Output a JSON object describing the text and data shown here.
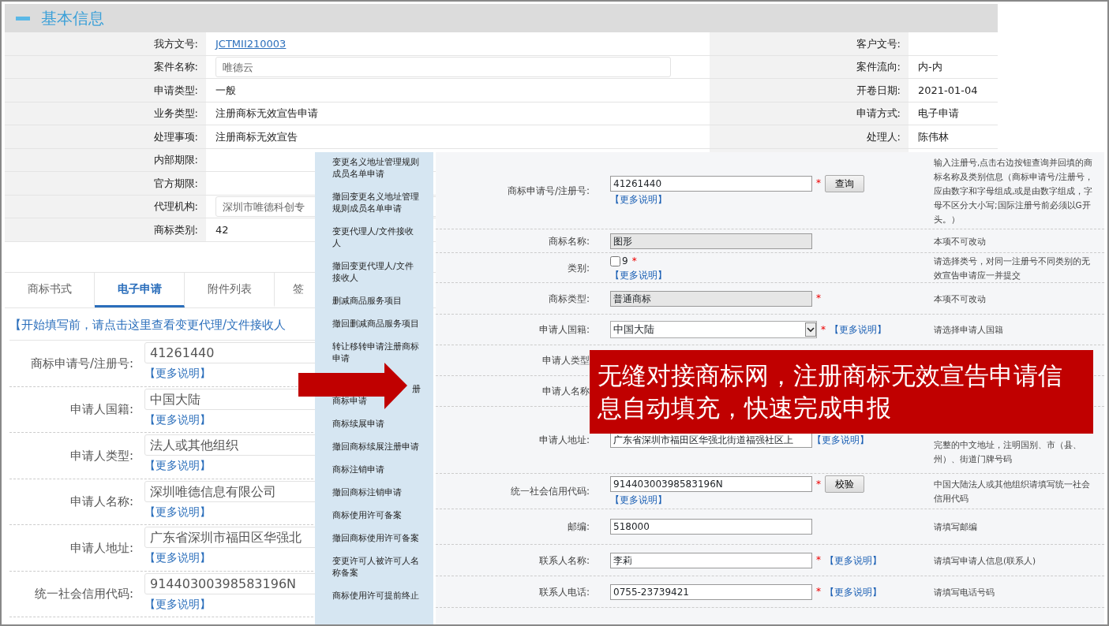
{
  "header": {
    "title": "基本信息"
  },
  "info_rows": [
    {
      "label": "我方文号:",
      "value": "JCTMII210003",
      "kind": "link",
      "right_label": "客户文号:"
    },
    {
      "label": "案件名称:",
      "value": "唯德云",
      "kind": "field",
      "right_label": "案件流向:",
      "right_value": "内-内"
    },
    {
      "label": "申请类型:",
      "value": "一般",
      "kind": "text",
      "right_label": "开卷日期:",
      "right_value": "2021-01-04"
    },
    {
      "label": "业务类型:",
      "value": "注册商标无效宣告申请",
      "kind": "text",
      "right_label": "申请方式:",
      "right_value": "电子申请"
    },
    {
      "label": "处理事项:",
      "value": "注册商标无效宣告",
      "kind": "text",
      "right_label": "处理人:",
      "right_value": "陈伟林"
    },
    {
      "label": "内部期限:"
    },
    {
      "label": "官方期限:"
    },
    {
      "label": "代理机构:",
      "value": "深圳市唯德科创专",
      "kind": "field"
    },
    {
      "label": "商标类别:",
      "value": "42",
      "kind": "text"
    }
  ],
  "tabs": [
    {
      "label": "商标书式",
      "selected": false
    },
    {
      "label": "电子申请",
      "selected": true
    },
    {
      "label": "附件列表",
      "selected": false
    },
    {
      "label": "签",
      "selected": false
    }
  ],
  "notice": "【开始填写前，请点击这里查看变更代理/文件接收人",
  "left_form": [
    {
      "label": "商标申请号/注册号:",
      "value": "41261440",
      "more": "【更多说明】"
    },
    {
      "label": "申请人国籍:",
      "value": "中国大陆",
      "more": "【更多说明】"
    },
    {
      "label": "申请人类型:",
      "value": "法人或其他组织",
      "more": "【更多说明】"
    },
    {
      "label": "申请人名称:",
      "value": "深圳唯德信息有限公司",
      "more": "【更多说明】"
    },
    {
      "label": "申请人地址:",
      "value": "广东省深圳市福田区华强北",
      "more": "【更多说明】"
    },
    {
      "label": "统一社会信用代码:",
      "value": "91440300398583196N",
      "more": "【更多说明】"
    }
  ],
  "menu": [
    {
      "kind": "item",
      "text": "变更名义地址管理规则成员名单申请"
    },
    {
      "kind": "item",
      "text": "撤回变更名义地址管理规则成员名单申请"
    },
    {
      "kind": "item",
      "text": "变更代理人/文件接收人"
    },
    {
      "kind": "item",
      "text": "撤回变更代理人/文件接收人"
    },
    {
      "kind": "item",
      "text": "删减商品服务项目"
    },
    {
      "kind": "item",
      "text": "撤回删减商品服务项目"
    },
    {
      "kind": "item",
      "text": "转让移转申请注册商标申请"
    },
    {
      "kind": "covered",
      "tail": "册",
      "text": "商标申请"
    },
    {
      "kind": "item",
      "text": "商标续展申请"
    },
    {
      "kind": "item",
      "text": "撤回商标续展注册申请"
    },
    {
      "kind": "item",
      "text": "商标注销申请"
    },
    {
      "kind": "item",
      "text": "撤回商标注销申请"
    },
    {
      "kind": "item",
      "text": "商标使用许可备案"
    },
    {
      "kind": "item",
      "text": "撤回商标使用许可备案"
    },
    {
      "kind": "item",
      "text": "变更许可人被许可人名称备案"
    },
    {
      "kind": "item",
      "text": "商标使用许可提前终止"
    }
  ],
  "right_form": [
    {
      "label": "商标申请号/注册号:",
      "kind": "text",
      "value": "41261440",
      "required_mark": "*",
      "button": "查询",
      "more": "【更多说明】",
      "hint": "输入注册号,点击右边按钮查询并回填的商标名称及类别信息（商标申请号/注册号，应由数字和字母组成,或是由数字组成，字母不区分大小写;国际注册号前必须以G开头。）"
    },
    {
      "label": "商标名称:",
      "kind": "disabled",
      "value": "图形",
      "hint": "本项不可改动"
    },
    {
      "label": "类别:",
      "kind": "checkbox",
      "value": "9",
      "checked": false,
      "required_mark": "*",
      "more": "【更多说明】",
      "hint": "请选择类号，对同一注册号不同类别的无效宣告申请应一并提交"
    },
    {
      "label": "商标类型:",
      "kind": "disabled",
      "value": "普通商标",
      "required_mark": "*",
      "hint": "本项不可改动"
    },
    {
      "label": "申请人国籍:",
      "kind": "select",
      "value": "中国大陆",
      "required_mark": "*",
      "more": "【更多说明】",
      "hint": "请选择申请人国籍"
    },
    {
      "label": "申请人类型",
      "kind": "covered"
    },
    {
      "label": "申请人名称",
      "kind": "covered"
    },
    {
      "label": "申请人地址:",
      "kind": "text",
      "value": "广东省深圳市福田区华强北街道福强社区上",
      "more": "【更多说明】",
      "hint": "完整的中文地址，注明国别、市（县、州）、街道门牌号码"
    },
    {
      "label": "统一社会信用代码:",
      "kind": "text",
      "value": "91440300398583196N",
      "required_mark": "*",
      "button": "校验",
      "more": "【更多说明】",
      "hint": "中国大陆法人或其他组织请填写统一社会信用代码"
    },
    {
      "label": "邮编:",
      "kind": "text",
      "value": "518000",
      "hint": "请填写邮编"
    },
    {
      "label": "联系人名称:",
      "kind": "text",
      "value": "李莉",
      "required_mark": "*",
      "more": "【更多说明】",
      "hint": "请填写申请人信息(联系人)"
    },
    {
      "label": "联系人电话:",
      "kind": "text",
      "value": "0755-23739421",
      "required_mark": "*",
      "more": "【更多说明】",
      "hint": "请填写电话号码"
    }
  ],
  "callout": "无缝对接商标网，注册商标无效宣告申请信息自动填充，快速完成申报"
}
